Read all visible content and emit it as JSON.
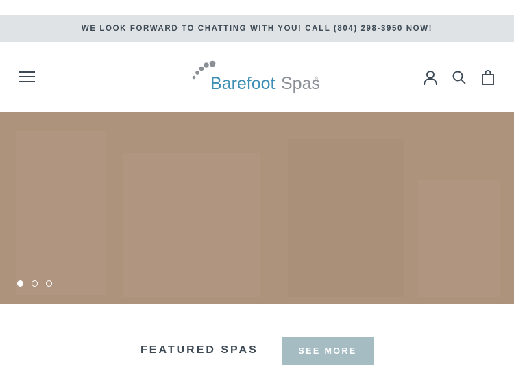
{
  "announcement": {
    "text": "WE LOOK FORWARD TO CHATTING WITH YOU! CALL (804) 298-3950 NOW!"
  },
  "header": {
    "logo": {
      "word1": "Barefoot",
      "word2": "Spas",
      "mark": "®"
    },
    "icons": [
      "menu-icon",
      "account-icon",
      "search-icon",
      "cart-icon"
    ]
  },
  "hero": {
    "slide_count": 3,
    "active_slide": 1
  },
  "featured": {
    "title": "FEATURED SPAS",
    "button_label": "SEE MORE"
  },
  "colors": {
    "announcement_bg": "#dfe3e5",
    "text_dark": "#3d4a55",
    "hero_bg": "#ae937c",
    "logo_blue": "#3d8fb3",
    "logo_gray": "#8a9096",
    "button_bg": "#a6bcc3"
  }
}
